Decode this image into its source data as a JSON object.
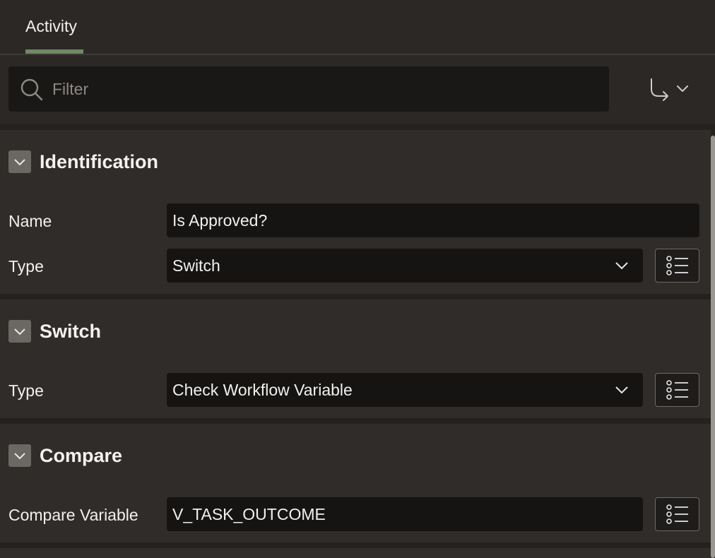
{
  "tabs": [
    {
      "label": "Activity"
    }
  ],
  "filter": {
    "placeholder": "Filter",
    "value": ""
  },
  "sections": {
    "identification": {
      "title": "Identification",
      "name_label": "Name",
      "name_value": "Is Approved?",
      "type_label": "Type",
      "type_value": "Switch"
    },
    "switch": {
      "title": "Switch",
      "type_label": "Type",
      "type_value": "Check Workflow Variable"
    },
    "compare": {
      "title": "Compare",
      "variable_label": "Compare Variable",
      "variable_value": "V_TASK_OUTCOME"
    }
  },
  "colors": {
    "accent": "#6f8a63",
    "background": "#2b2826",
    "field_bg": "#161412"
  },
  "icons": [
    "search-icon",
    "go-to-icon",
    "chevron-down-icon",
    "list-icon"
  ]
}
